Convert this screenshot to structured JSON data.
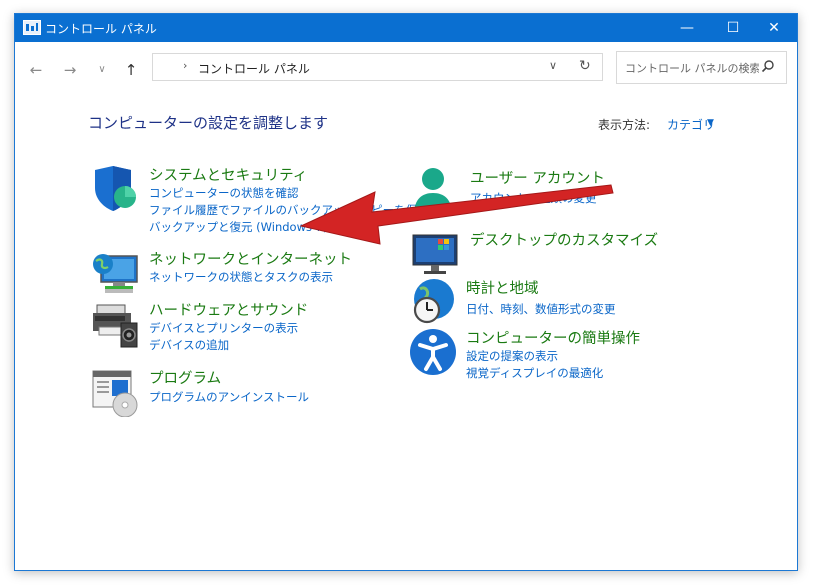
{
  "window": {
    "title": "コントロール パネル",
    "controls": {
      "minimize": "—",
      "maximize": "☐",
      "close": "✕"
    }
  },
  "nav": {
    "back": "←",
    "forward": "→",
    "recent": "∨",
    "up": "↑",
    "breadcrumb_separator": "›",
    "breadcrumb": "コントロール パネル",
    "dropdown": "∨",
    "refresh": "↻",
    "search_placeholder": "コントロール パネルの検索"
  },
  "main": {
    "heading": "コンピューターの設定を調整します",
    "view_by_label": "表示方法:",
    "view_by_value": "カテゴリ",
    "view_by_caret": "▼"
  },
  "categories_left": [
    {
      "title": "システムとセキュリティ",
      "links": [
        "コンピューターの状態を確認",
        "ファイル履歴でファイルのバックアップ コピーを保存",
        "バックアップと復元 (Windows 7)"
      ]
    },
    {
      "title": "ネットワークとインターネット",
      "links": [
        "ネットワークの状態とタスクの表示"
      ]
    },
    {
      "title": "ハードウェアとサウンド",
      "links": [
        "デバイスとプリンターの表示",
        "デバイスの追加"
      ]
    },
    {
      "title": "プログラム",
      "links": [
        "プログラムのアンインストール"
      ]
    }
  ],
  "categories_right": [
    {
      "title": "ユーザー アカウント",
      "links": [
        "アカウントの種類の変更"
      ]
    },
    {
      "title": "デスクトップのカスタマイズ",
      "links": []
    },
    {
      "title": "時計と地域",
      "links": [
        "日付、時刻、数値形式の変更"
      ]
    },
    {
      "title": "コンピューターの簡単操作",
      "links": [
        "設定の提案の表示",
        "視覚ディスプレイの最適化"
      ]
    }
  ],
  "colors": {
    "titlebar": "#0a6fd1",
    "category_title": "#1a7a12",
    "link": "#0a66c8",
    "heading": "#1e3287",
    "arrow": "#d32424"
  }
}
